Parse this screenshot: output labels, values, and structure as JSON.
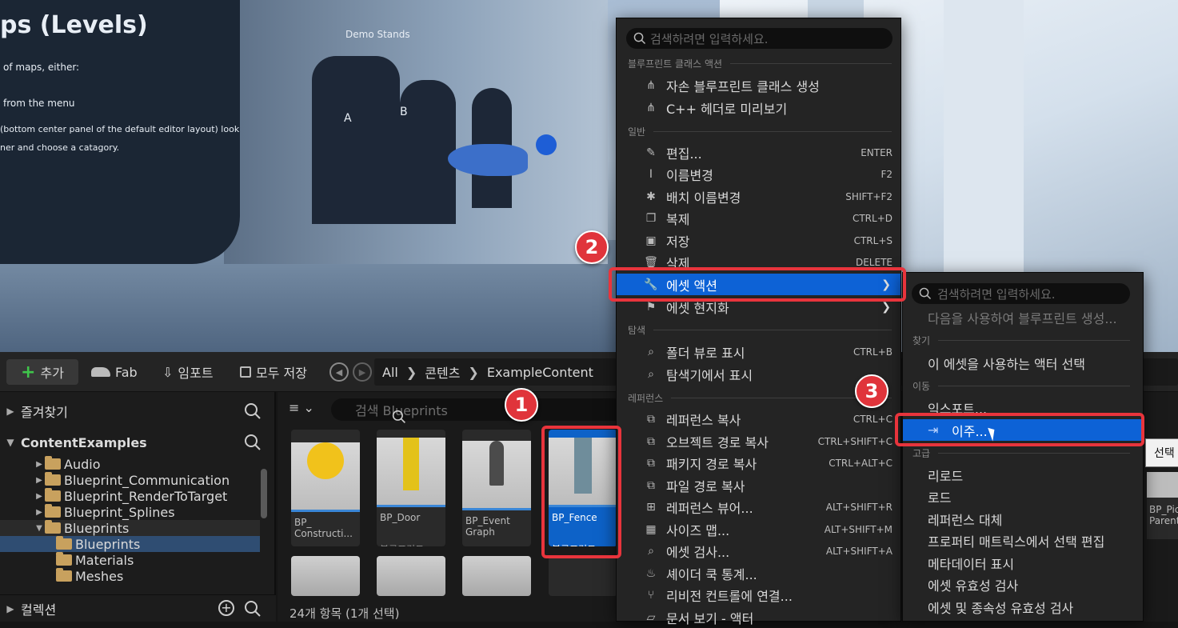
{
  "viewport": {
    "text_lines": [
      "ps (Levels)",
      "of maps, either:",
      "from the menu",
      "(bottom center panel of the default editor layout) look",
      "ner and choose a catagory."
    ],
    "stand_title": "Demo Stands",
    "stand_a": "A",
    "stand_b": "B"
  },
  "toolbar": {
    "add_label": "추가",
    "fab_label": "Fab",
    "import_label": "임포트",
    "save_all_label": "모두 저장",
    "breadcrumb": [
      "All",
      "콘텐츠",
      "ExampleContent"
    ]
  },
  "left_panel": {
    "favorites_label": "즐겨찾기",
    "root_label": "ContentExamples",
    "folders": [
      "Audio",
      "Blueprint_Communication",
      "Blueprint_RenderToTarget",
      "Blueprint_Splines",
      "Blueprints",
      "Blueprints",
      "Materials",
      "Meshes"
    ],
    "collections_label": "컬렉션"
  },
  "content": {
    "search_placeholder": "검색 Blueprints",
    "tiles": [
      {
        "name": "BP_\nConstructi...",
        "type": "블루프린트 클..."
      },
      {
        "name": "BP_Door",
        "type": "블루프린트 클..."
      },
      {
        "name": "BP_Event\nGraph",
        "type": "블루프린트 클..."
      },
      {
        "name": "BP_Fence",
        "type": "블루프린트 클..."
      }
    ],
    "right_tile_name": "BP_Pic\nParent",
    "status": "24개 항목 (1개 선택)"
  },
  "context_menu": {
    "search_placeholder": "검색하려면 입력하세요.",
    "sections": {
      "blueprint_class_actions": "블루프린트 클래스 액션",
      "general": "일반",
      "explore": "탐색",
      "references": "레퍼런스"
    },
    "bp_items": [
      {
        "label": "자손 블루프린트 클래스 생성",
        "icon": "hierarchy-icon"
      },
      {
        "label": "C++ 헤더로 미리보기",
        "icon": "cpp-icon"
      }
    ],
    "general_items": [
      {
        "label": "편집...",
        "shortcut": "ENTER"
      },
      {
        "label": "이름변경",
        "shortcut": "F2"
      },
      {
        "label": "배치 이름변경",
        "shortcut": "SHIFT+F2"
      },
      {
        "label": "복제",
        "shortcut": "CTRL+D"
      },
      {
        "label": "저장",
        "shortcut": "CTRL+S"
      },
      {
        "label": "삭제",
        "shortcut": "DELETE"
      },
      {
        "label": "에셋 액션",
        "shortcut": ""
      },
      {
        "label": "에셋 현지화",
        "shortcut": ""
      }
    ],
    "explore_items": [
      {
        "label": "폴더 뷰로 표시",
        "shortcut": "CTRL+B"
      },
      {
        "label": "탐색기에서 표시",
        "shortcut": ""
      }
    ],
    "reference_items": [
      {
        "label": "레퍼런스 복사",
        "shortcut": "CTRL+C"
      },
      {
        "label": "오브젝트 경로 복사",
        "shortcut": "CTRL+SHIFT+C"
      },
      {
        "label": "패키지 경로 복사",
        "shortcut": "CTRL+ALT+C"
      },
      {
        "label": "파일 경로 복사",
        "shortcut": ""
      },
      {
        "label": "레퍼런스 뷰어...",
        "shortcut": "ALT+SHIFT+R"
      },
      {
        "label": "사이즈 맵...",
        "shortcut": "ALT+SHIFT+M"
      },
      {
        "label": "에셋 검사...",
        "shortcut": "ALT+SHIFT+A"
      },
      {
        "label": "셰이더 쿡 통계...",
        "shortcut": ""
      },
      {
        "label": "리비전 컨트롤에 연결...",
        "shortcut": ""
      },
      {
        "label": "문서 보기 - 액터",
        "shortcut": ""
      }
    ]
  },
  "submenu": {
    "search_placeholder": "검색하려면 입력하세요.",
    "create_bp_disabled": "다음을 사용하여 블루프린트 생성...",
    "sections": {
      "find": "찾기",
      "move": "이동",
      "advanced": "고급"
    },
    "find_items": [
      "이 에셋을 사용하는 액터 선택"
    ],
    "move_items": [
      "익스포트...",
      "이주..."
    ],
    "advanced_items": [
      "리로드",
      "로드",
      "레퍼런스 대체",
      "프로퍼티 매트릭스에서 선택 편집",
      "메타데이터 표시",
      "에셋 유효성 검사",
      "에셋 및 종속성 유효성 검사"
    ]
  },
  "tooltip": "선택",
  "badges": [
    "1",
    "2",
    "3"
  ],
  "colors": {
    "highlight": "#0d62d6",
    "callout": "#e8343c",
    "add_plus": "#3fc54b"
  }
}
